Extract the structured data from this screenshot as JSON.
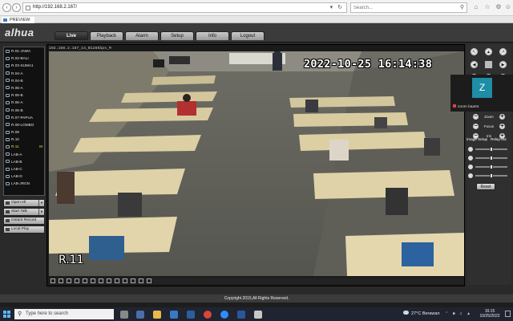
{
  "browser": {
    "url": "http://192.168.2.167/",
    "search_placeholder": "Search...",
    "tab_title": "PREVIEW"
  },
  "app": {
    "logo": "alhua",
    "nav": [
      "Live",
      "Playback",
      "Alarm",
      "Setup",
      "Info",
      "Logout"
    ],
    "active_nav": "Live"
  },
  "channels": [
    "R.01-JAWA",
    "R.02-BALI",
    "R.03-SUMA1",
    "R.04-A",
    "R.04-B",
    "R.05-A",
    "R.05-B",
    "R.06-A",
    "R.06-B",
    "R.07-PAPUA",
    "R.08-LOMBO",
    "R.09",
    "R.10",
    "R.11",
    "LAB-A",
    "LAB-B",
    "LAB-C",
    "LAB-D",
    "LAB-JRGN"
  ],
  "selected_channel_flag": "M",
  "side_controls": {
    "open_all": "Open All",
    "start_talk": "Start Talk",
    "instant_record": "Instant Record",
    "local_play": "Local Play"
  },
  "video": {
    "caption": "192.168.2.167_14_B128kbps_M",
    "timestamp": "2022-10-25 16:14:38",
    "room_label": "R.11"
  },
  "ptz": {
    "labels": [
      "Zoom",
      "Focus",
      "Iris"
    ],
    "image_setup": "Image Setup",
    "relay_out": "Relay-out",
    "reset": "Reset",
    "adjust_levels": [
      0.5,
      0.5,
      0.5,
      0.5
    ]
  },
  "zoom_overlay": {
    "initial": "Z",
    "name": "zoom baa04"
  },
  "footer": {
    "copyright": "Copyright 2015,All Rights Reserved."
  },
  "taskbar": {
    "search_placeholder": "Type here to search",
    "weather": "27°C  Berawan",
    "time": "16:15",
    "date": "10/25/2022"
  },
  "colors": {
    "header_bg": "#3b3b3b",
    "active_tab_bg": "#222222",
    "zoom_avatar": "#1d8ea6",
    "selected_channel": "#ffd75a"
  }
}
